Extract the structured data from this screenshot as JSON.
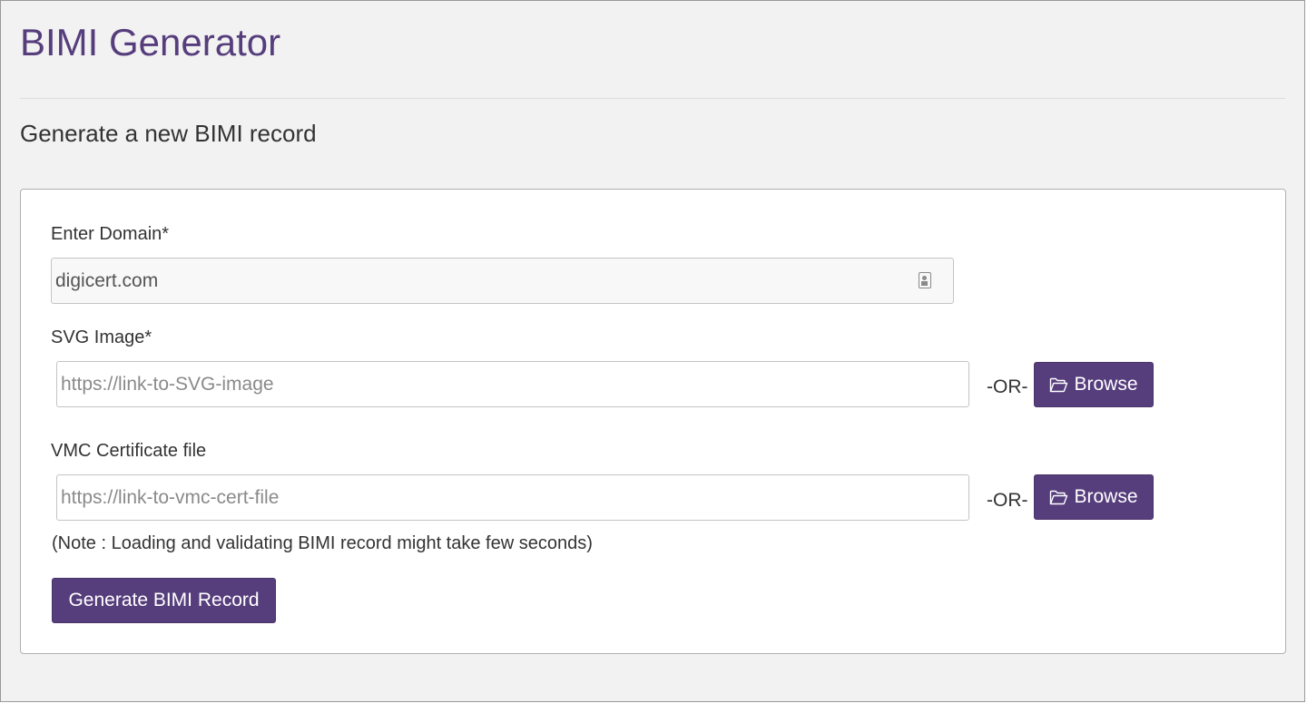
{
  "app": {
    "title": "BIMI Generator",
    "accent_color": "#563d7c"
  },
  "section": {
    "title": "Generate a new BIMI record"
  },
  "form": {
    "domain": {
      "label": "Enter Domain*",
      "value": "digicert.com",
      "icon": "contact-card-icon"
    },
    "svg_image": {
      "label": "SVG Image*",
      "placeholder": "https://link-to-SVG-image",
      "or_text": "-OR-",
      "browse_label": "Browse",
      "browse_icon": "folder-open-icon"
    },
    "vmc_certificate": {
      "label": "VMC Certificate file",
      "placeholder": "https://link-to-vmc-cert-file",
      "or_text": "-OR-",
      "browse_label": "Browse",
      "browse_icon": "folder-open-icon"
    },
    "note": "(Note : Loading and validating BIMI record might take few seconds)",
    "submit_label": "Generate BIMI Record"
  }
}
